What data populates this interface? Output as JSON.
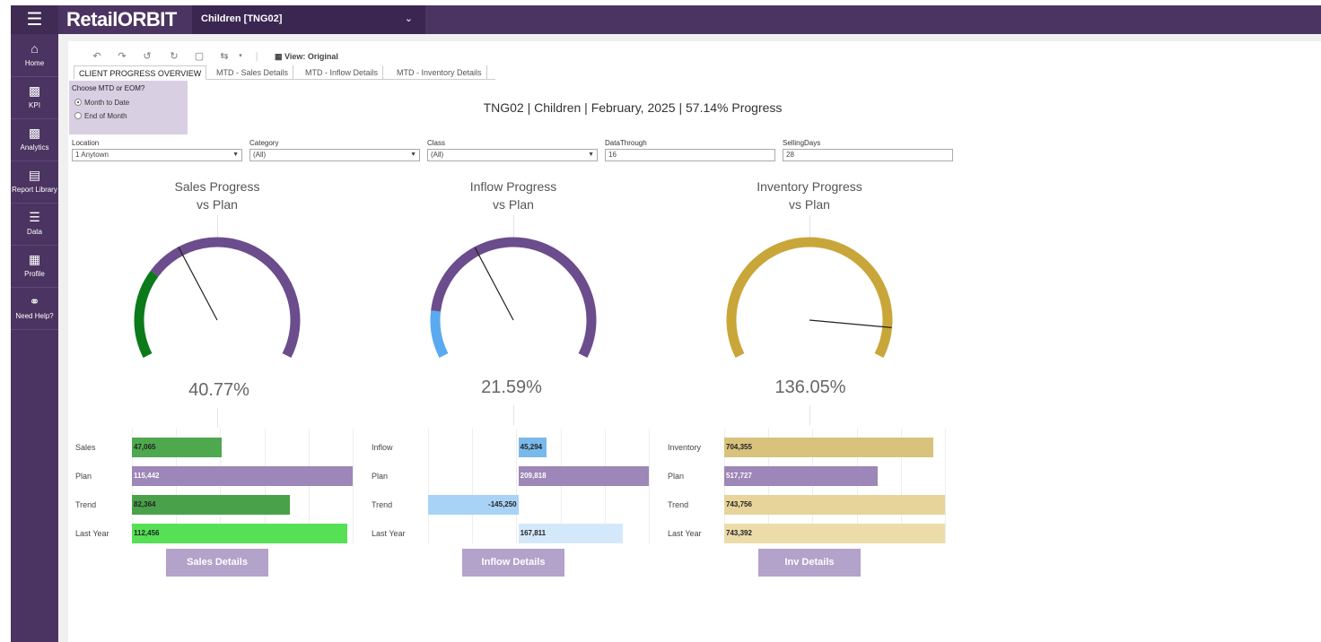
{
  "header": {
    "brand": "RetailORBIT",
    "workspace": "Children [TNG02]"
  },
  "sidebar": {
    "items": [
      {
        "label": "Home",
        "icon": "home-icon"
      },
      {
        "label": "KPI",
        "icon": "kpi-chart-icon"
      },
      {
        "label": "Analytics",
        "icon": "analytics-icon"
      },
      {
        "label": "Report Library",
        "icon": "report-library-icon"
      },
      {
        "label": "Data",
        "icon": "data-list-icon"
      },
      {
        "label": "Profile",
        "icon": "profile-grid-icon"
      },
      {
        "label": "Need Help?",
        "icon": "help-headset-icon"
      }
    ]
  },
  "toolbar": {
    "view_label": "View: Original"
  },
  "tabs": [
    {
      "label": "CLIENT PROGRESS OVERVIEW",
      "active": true
    },
    {
      "label": "MTD - Sales Details",
      "active": false
    },
    {
      "label": "MTD - Inflow Details",
      "active": false
    },
    {
      "label": "MTD - Inventory Details",
      "active": false
    }
  ],
  "mtd_selector": {
    "title": "Choose MTD or EOM?",
    "options": [
      {
        "label": "Month to Date",
        "selected": true
      },
      {
        "label": "End of Month",
        "selected": false
      }
    ]
  },
  "page_title": "TNG02 | Children | February, 2025 | 57.14% Progress",
  "filters": [
    {
      "label": "Location",
      "value": "1 Anytown",
      "type": "dropdown"
    },
    {
      "label": "Category",
      "value": "(All)",
      "type": "dropdown"
    },
    {
      "label": "Class",
      "value": "(All)",
      "type": "dropdown"
    },
    {
      "label": "DataThrough",
      "value": "16",
      "type": "text"
    },
    {
      "label": "SellingDays",
      "value": "28",
      "type": "text"
    }
  ],
  "chart_data": [
    {
      "type": "gauge",
      "title_line1": "Sales Progress",
      "title_line2": "vs Plan",
      "value_label": "40.77%",
      "value": 40.77,
      "needle": 57.14,
      "colors": {
        "fill": "#0b7a1b",
        "rest": "#6b4c8c"
      }
    },
    {
      "type": "gauge",
      "title_line1": "Inflow Progress",
      "title_line2": "vs Plan",
      "value_label": "21.59%",
      "value": 21.59,
      "needle": 57.14,
      "colors": {
        "fill": "#5aaaf0",
        "rest": "#6b4c8c"
      }
    },
    {
      "type": "gauge",
      "title_line1": "Inventory Progress",
      "title_line2": "vs Plan",
      "value_label": "136.05%",
      "value": 136.05,
      "needle": 136.05,
      "colors": {
        "fill": "#c9a63a",
        "rest": "#c9a63a"
      }
    },
    {
      "type": "bar",
      "categories": [
        "Sales",
        "Plan",
        "Trend",
        "Last Year"
      ],
      "values": [
        47065,
        115442,
        82364,
        112456
      ],
      "labels": [
        "47,065",
        "115,442",
        "82,364",
        "112,456"
      ],
      "xlim": [
        0,
        115442
      ],
      "colors": [
        "#4ea84e",
        "#9d86b8",
        "#49a249",
        "#55e055"
      ],
      "button": "Sales Details"
    },
    {
      "type": "bar",
      "categories": [
        "Inflow",
        "Plan",
        "Trend",
        "Last Year"
      ],
      "values": [
        45294,
        209818,
        -145250,
        167811
      ],
      "labels": [
        "45,294",
        "209,818",
        "-145,250",
        "167,811"
      ],
      "xlim": [
        -145250,
        209818
      ],
      "colors": [
        "#79b9ec",
        "#9d86b8",
        "#a9d3f6",
        "#d4e8fb"
      ],
      "button": "Inflow Details"
    },
    {
      "type": "bar",
      "categories": [
        "Inventory",
        "Plan",
        "Trend",
        "Last Year"
      ],
      "values": [
        704355,
        517727,
        743756,
        743392
      ],
      "labels": [
        "704,355",
        "517,727",
        "743,756",
        "743,392"
      ],
      "xlim": [
        0,
        743756
      ],
      "colors": [
        "#d8c27c",
        "#9d86b8",
        "#e6d49a",
        "#ebdcaa"
      ],
      "button": "Inv Details"
    }
  ]
}
